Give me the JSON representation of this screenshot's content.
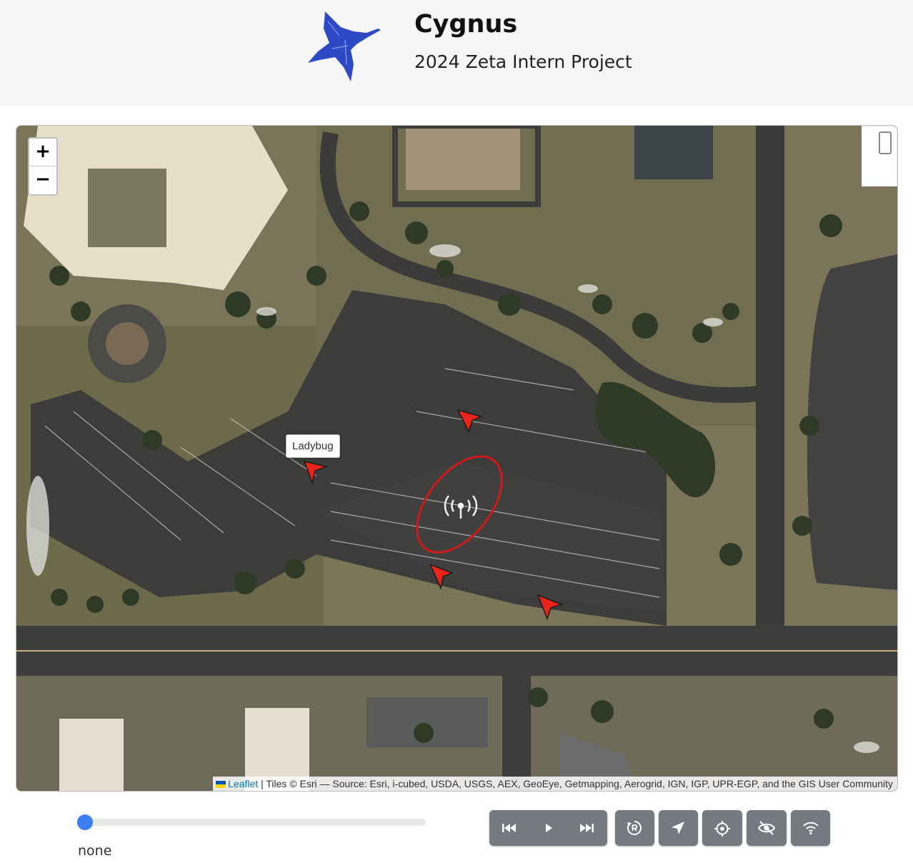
{
  "header": {
    "title": "Cygnus",
    "subtitle": "2024 Zeta Intern Project"
  },
  "map": {
    "zoom_in_label": "+",
    "zoom_out_label": "−",
    "tooltip": "Ladybug",
    "attribution": {
      "leaflet_link": "Leaflet",
      "text": " | Tiles © Esri — Source: Esri, i-cubed, USDA, USGS, AEX, GeoEye, Getmapping, Aerogrid, IGN, IGP, UPR-EGP, and the GIS User Community"
    },
    "marker_color": "#e8241c",
    "ellipse_color": "#d0181a"
  },
  "controls": {
    "timeline_status": "none",
    "timeline_position": 0,
    "buttons": [
      "skip-back-icon",
      "play-icon",
      "skip-forward-icon",
      "replay-icon",
      "navigate-icon",
      "target-icon",
      "eye-off-icon",
      "wifi-icon"
    ],
    "button_color": "#757a80",
    "accent": "#3b7ef0"
  }
}
